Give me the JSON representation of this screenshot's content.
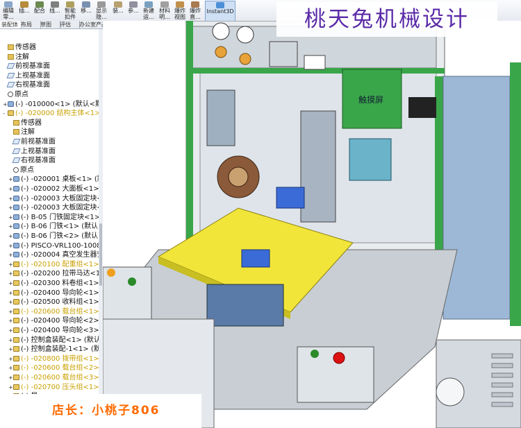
{
  "toolbar": {
    "buttons": [
      {
        "label": "编辑零...",
        "color": "#8aa6c8"
      },
      {
        "label": "插...",
        "color": "#b68b3a"
      },
      {
        "label": "配合",
        "color": "#6c8a50"
      },
      {
        "label": "线...",
        "color": "#7f7f7f"
      },
      {
        "label": "智能扣件",
        "color": "#b0a060"
      },
      {
        "label": "移...",
        "color": "#7a90b0"
      },
      {
        "label": "显示隐...",
        "color": "#999"
      },
      {
        "label": "装...",
        "color": "#b8a070"
      },
      {
        "label": "参...",
        "color": "#9090a0"
      },
      {
        "label": "新建运...",
        "color": "#7aa0c0"
      },
      {
        "label": "材料明...",
        "color": "#a0a0a0"
      },
      {
        "label": "爆炸视图",
        "color": "#c0904a"
      },
      {
        "label": "爆炸直...",
        "color": "#aa7a50"
      },
      {
        "label": "Instant3D",
        "color": "#4d8fd6",
        "active": true
      }
    ]
  },
  "tabs": [
    "装配体",
    "布局",
    "草图",
    "评估",
    "办公室产品"
  ],
  "tree": {
    "items": [
      {
        "indent": 0,
        "icon": "fold",
        "exp": "",
        "label": "传感器"
      },
      {
        "indent": 0,
        "icon": "fold",
        "exp": "",
        "label": "注解"
      },
      {
        "indent": 0,
        "icon": "plane",
        "exp": "",
        "label": "前视基准面"
      },
      {
        "indent": 0,
        "icon": "plane",
        "exp": "",
        "label": "上视基准面"
      },
      {
        "indent": 0,
        "icon": "plane",
        "exp": "",
        "label": "右视基准面"
      },
      {
        "indent": 0,
        "icon": "pt",
        "exp": "",
        "label": "原点"
      },
      {
        "indent": 0,
        "icon": "part",
        "exp": "+",
        "label": "(-) -010000<1> (默认<默认"
      },
      {
        "indent": 0,
        "icon": "asm",
        "exp": "-",
        "label": "(-) -020000 结构主体<1>",
        "hl": true
      },
      {
        "indent": 1,
        "icon": "fold",
        "exp": "",
        "label": "传感器"
      },
      {
        "indent": 1,
        "icon": "fold",
        "exp": "",
        "label": "注解"
      },
      {
        "indent": 1,
        "icon": "plane",
        "exp": "",
        "label": "前视基准面"
      },
      {
        "indent": 1,
        "icon": "plane",
        "exp": "",
        "label": "上视基准面"
      },
      {
        "indent": 1,
        "icon": "plane",
        "exp": "",
        "label": "右视基准面"
      },
      {
        "indent": 1,
        "icon": "pt",
        "exp": "",
        "label": "原点"
      },
      {
        "indent": 1,
        "icon": "part",
        "exp": "+",
        "label": "(-) -020001 桌板<1> (默"
      },
      {
        "indent": 1,
        "icon": "part",
        "exp": "+",
        "label": "(-) -020002 大面板<1> ("
      },
      {
        "indent": 1,
        "icon": "part",
        "exp": "+",
        "label": "(-) -020003 大板固定块<1"
      },
      {
        "indent": 1,
        "icon": "part",
        "exp": "+",
        "label": "(-) -020003 大板固定块<2"
      },
      {
        "indent": 1,
        "icon": "part",
        "exp": "+",
        "label": "(-) B-05 门铁固定块<1> ("
      },
      {
        "indent": 1,
        "icon": "part",
        "exp": "+",
        "label": "(-) B-06 门铁<1> (默认<"
      },
      {
        "indent": 1,
        "icon": "part",
        "exp": "+",
        "label": "(-) B-06 门铁<2> (默认<"
      },
      {
        "indent": 1,
        "icon": "part",
        "exp": "+",
        "label": "(-) PISCO-VRL100-1008"
      },
      {
        "indent": 1,
        "icon": "part",
        "exp": "+",
        "label": "(-) -020004 真空发生器安"
      },
      {
        "indent": 1,
        "icon": "asm",
        "exp": "+",
        "label": "(-) -020100 配重组<1> (",
        "hl": true
      },
      {
        "indent": 1,
        "icon": "asm",
        "exp": "+",
        "label": "(-) -020200 拉带马达<1>"
      },
      {
        "indent": 1,
        "icon": "asm",
        "exp": "+",
        "label": "(-) -020300 料卷组<1> ("
      },
      {
        "indent": 1,
        "icon": "asm",
        "exp": "+",
        "label": "(-) -020400 导向轮<1> ("
      },
      {
        "indent": 1,
        "icon": "asm",
        "exp": "+",
        "label": "(-) -020500 收料组<1> ("
      },
      {
        "indent": 1,
        "icon": "asm",
        "exp": "+",
        "label": "(-) -020600 载台组<1> (",
        "hl": true
      },
      {
        "indent": 1,
        "icon": "asm",
        "exp": "+",
        "label": "(-) -020400 导向轮<2> ("
      },
      {
        "indent": 1,
        "icon": "asm",
        "exp": "+",
        "label": "(-) -020400 导向轮<3> ("
      },
      {
        "indent": 1,
        "icon": "asm",
        "exp": "+",
        "label": "(-) 控制盒装配<1> (默认"
      },
      {
        "indent": 1,
        "icon": "asm",
        "exp": "+",
        "label": "(-) 控制盒装配-1<1> (默"
      },
      {
        "indent": 1,
        "icon": "asm",
        "exp": "+",
        "label": "(-) -020800 拨带组<1>",
        "hl": true
      },
      {
        "indent": 1,
        "icon": "asm",
        "exp": "+",
        "label": "(-) -020600 载台组<2>",
        "hl": true
      },
      {
        "indent": 1,
        "icon": "asm",
        "exp": "+",
        "label": "(-) -020600 载台组<3>",
        "hl": true
      },
      {
        "indent": 1,
        "icon": "asm",
        "exp": "+",
        "label": "(-) -020700 压头组<1>",
        "hl": true
      },
      {
        "indent": 1,
        "icon": "asm",
        "exp": "+",
        "label": "(-) 导"
      },
      {
        "indent": 1,
        "icon": "asm",
        "exp": "+",
        "label": "(-) -0"
      },
      {
        "indent": 1,
        "icon": "asm",
        "exp": "+",
        "label": "(-) -0"
      }
    ]
  },
  "watermark": "桃天兔机械设计",
  "shop_label": "店长：小桃子806",
  "touch_label": "触摸屏"
}
